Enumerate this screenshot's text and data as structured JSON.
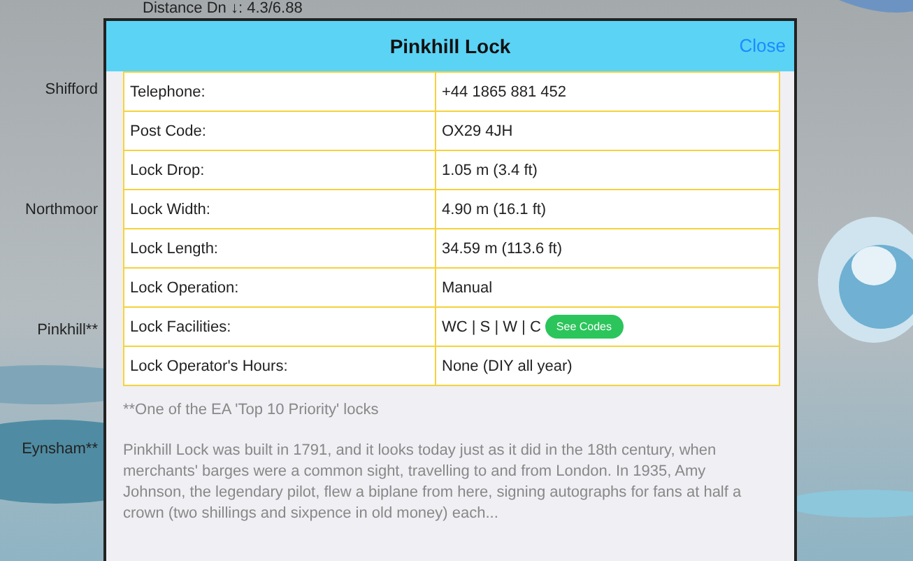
{
  "background": {
    "kind": "picture",
    "distance": "Distance Dn ↓: 4.3/6.88",
    "locks": [
      "Shifford",
      "Northmoor",
      "Pinkhill**",
      "Eynsham**"
    ]
  },
  "dialog": {
    "title": "Pinkhill Lock",
    "close": "Close",
    "rows": [
      {
        "label": "Telephone:",
        "value": "+44 1865 881 452"
      },
      {
        "label": "Post Code:",
        "value": "OX29 4JH"
      },
      {
        "label": "Lock Drop:",
        "value": "1.05 m (3.4 ft)"
      },
      {
        "label": "Lock Width:",
        "value": "4.90 m (16.1 ft)"
      },
      {
        "label": "Lock Length:",
        "value": "34.59 m (113.6 ft)"
      },
      {
        "label": "Lock Operation:",
        "value": "Manual"
      },
      {
        "label": "Lock Facilities:",
        "value": "WC | S | W | C",
        "button": "See Codes"
      },
      {
        "label": "Lock Operator's Hours:",
        "value": "None (DIY all year)"
      }
    ],
    "footnote": "**One of the EA 'Top 10 Priority' locks",
    "description": "Pinkhill Lock was built in 1791, and it looks today just as it did in the 18th century, when merchants' barges were a common sight, travelling to and from London. In 1935, Amy Johnson, the legendary pilot, flew a biplane from here, signing autographs for fans at half a crown (two shillings and sixpence in old money) each..."
  }
}
